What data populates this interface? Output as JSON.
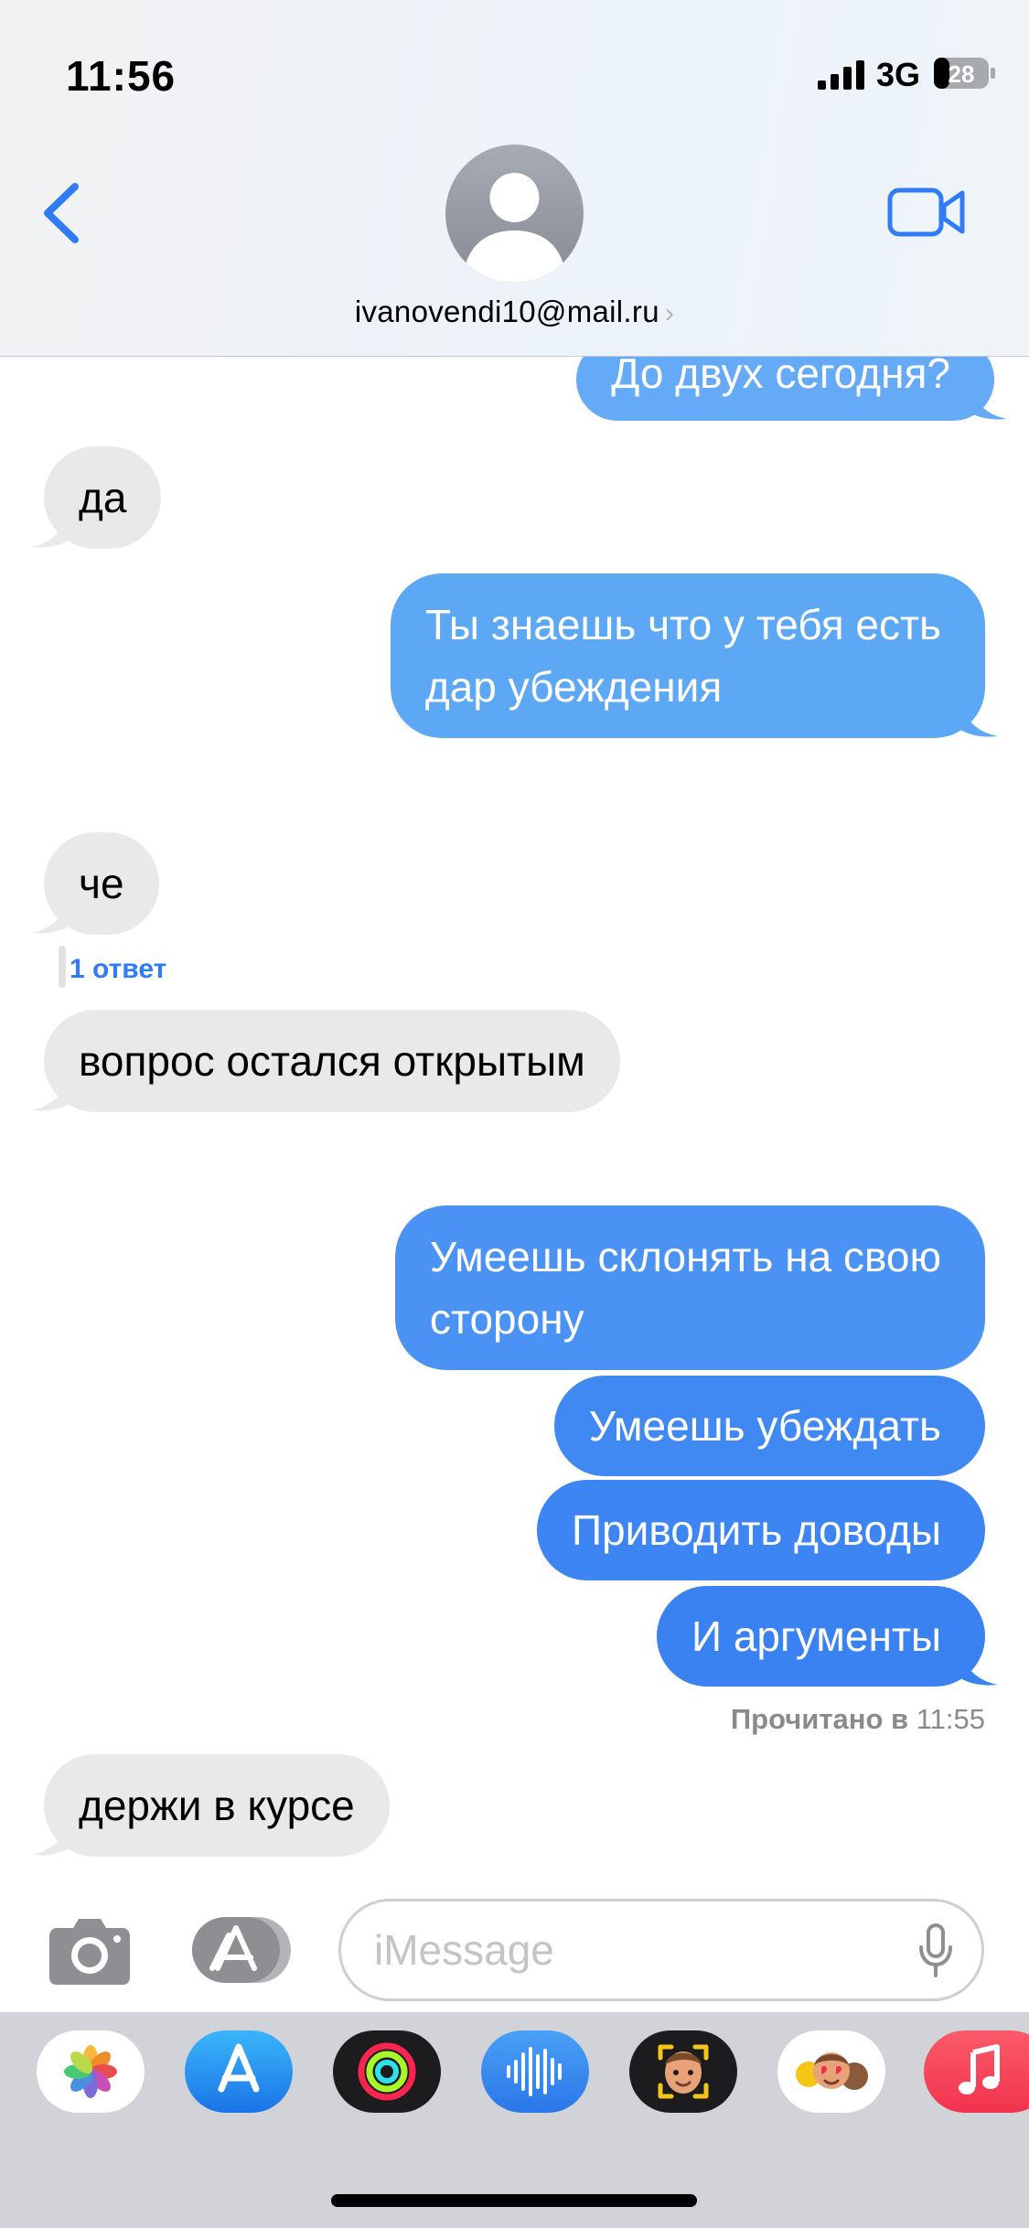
{
  "status_bar": {
    "time": "11:56",
    "network": "3G",
    "battery": "28"
  },
  "header": {
    "contact": "ivanovendi10@mail.ru"
  },
  "messages": [
    {
      "side": "out",
      "text": "До двух сегодня?"
    },
    {
      "side": "in",
      "text": "да"
    },
    {
      "side": "out",
      "lines": [
        "Ты знаешь что у тебя есть",
        "дар убеждения"
      ]
    },
    {
      "side": "in",
      "text": "че"
    },
    {
      "side": "in",
      "text": "вопрос остался открытым"
    },
    {
      "side": "out",
      "lines": [
        "Умеешь склонять на свою",
        "сторону"
      ]
    },
    {
      "side": "out",
      "text": "Умеешь убеждать"
    },
    {
      "side": "out",
      "text": "Приводить доводы"
    },
    {
      "side": "out",
      "text": "И аргументы"
    },
    {
      "side": "in",
      "text": "держи в курсе"
    }
  ],
  "reply_count": {
    "number": "1",
    "label": "ответ"
  },
  "read_receipt": {
    "label": "Прочитано в",
    "time": "11:55"
  },
  "input": {
    "placeholder": "iMessage"
  },
  "app_drawer": [
    "photos-app",
    "app-store-app",
    "activity-app",
    "voice-memos-app",
    "memoji-app",
    "animoji-stickers-app",
    "music-app"
  ],
  "colors": {
    "bubble_out_top": "#5ea8f5",
    "bubble_out_bottom": "#3a7ff2",
    "bubble_in": "#e9e9eb",
    "accent": "#2f7cf6"
  }
}
